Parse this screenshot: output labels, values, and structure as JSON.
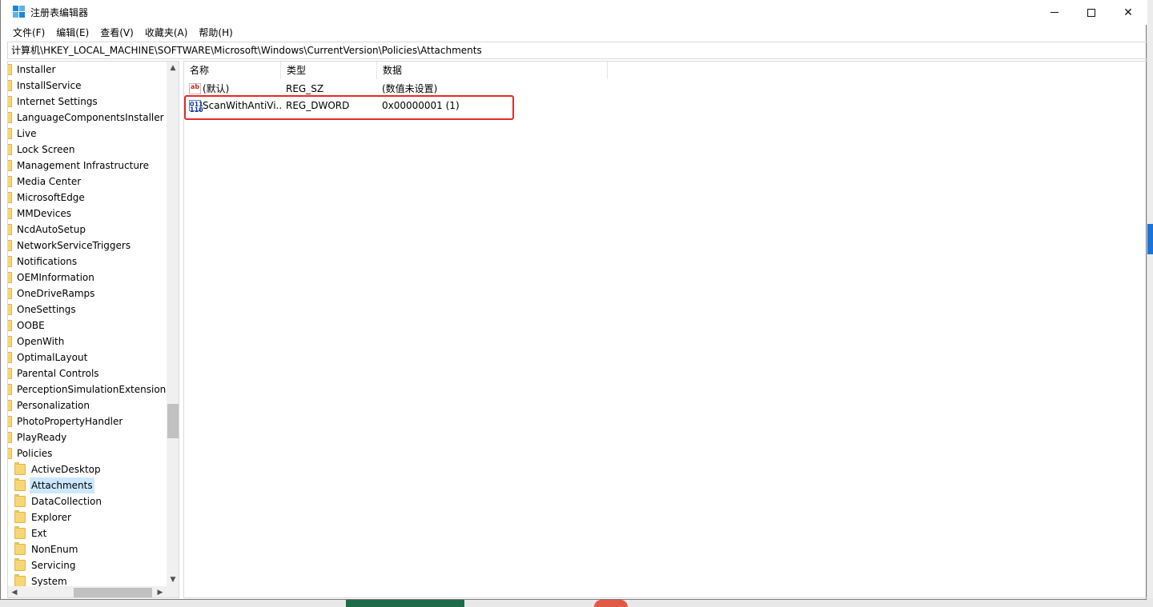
{
  "window": {
    "title": "注册表编辑器",
    "minimize_label": "—",
    "maximize_label": "",
    "close_label": "✕"
  },
  "menu": [
    "文件(F)",
    "编辑(E)",
    "查看(V)",
    "收藏夹(A)",
    "帮助(H)"
  ],
  "address": "计算机\\HKEY_LOCAL_MACHINE\\SOFTWARE\\Microsoft\\Windows\\CurrentVersion\\Policies\\Attachments",
  "tree": {
    "items": [
      {
        "label": "Installer",
        "level": 1
      },
      {
        "label": "InstallService",
        "level": 1
      },
      {
        "label": "Internet Settings",
        "level": 1
      },
      {
        "label": "LanguageComponentsInstaller",
        "level": 1
      },
      {
        "label": "Live",
        "level": 1
      },
      {
        "label": "Lock Screen",
        "level": 1
      },
      {
        "label": "Management Infrastructure",
        "level": 1
      },
      {
        "label": "Media Center",
        "level": 1
      },
      {
        "label": "MicrosoftEdge",
        "level": 1
      },
      {
        "label": "MMDevices",
        "level": 1
      },
      {
        "label": "NcdAutoSetup",
        "level": 1
      },
      {
        "label": "NetworkServiceTriggers",
        "level": 1
      },
      {
        "label": "Notifications",
        "level": 1
      },
      {
        "label": "OEMInformation",
        "level": 1
      },
      {
        "label": "OneDriveRamps",
        "level": 1
      },
      {
        "label": "OneSettings",
        "level": 1
      },
      {
        "label": "OOBE",
        "level": 1
      },
      {
        "label": "OpenWith",
        "level": 1
      },
      {
        "label": "OptimalLayout",
        "level": 1
      },
      {
        "label": "Parental Controls",
        "level": 1
      },
      {
        "label": "PerceptionSimulationExtensions",
        "level": 1
      },
      {
        "label": "Personalization",
        "level": 1
      },
      {
        "label": "PhotoPropertyHandler",
        "level": 1
      },
      {
        "label": "PlayReady",
        "level": 1
      },
      {
        "label": "Policies",
        "level": 1
      },
      {
        "label": "ActiveDesktop",
        "level": 2
      },
      {
        "label": "Attachments",
        "level": 2,
        "selected": true
      },
      {
        "label": "DataCollection",
        "level": 2
      },
      {
        "label": "Explorer",
        "level": 2
      },
      {
        "label": "Ext",
        "level": 2
      },
      {
        "label": "NonEnum",
        "level": 2
      },
      {
        "label": "Servicing",
        "level": 2
      },
      {
        "label": "System",
        "level": 2
      }
    ]
  },
  "values": {
    "columns": {
      "name": "名称",
      "type": "类型",
      "data": "数据"
    },
    "rows": [
      {
        "icon": "string-value-icon",
        "name": "(默认)",
        "type": "REG_SZ",
        "data": "(数值未设置)"
      },
      {
        "icon": "binary-value-icon",
        "name": "ScanWithAntiVi...",
        "type": "REG_DWORD",
        "data": "0x00000001 (1)"
      }
    ]
  },
  "icons": {
    "string": "ab",
    "binary": "011\n110"
  },
  "colors": {
    "highlight": "#e32b2b",
    "selection": "#cce8ff",
    "folder": "#f7d675"
  }
}
